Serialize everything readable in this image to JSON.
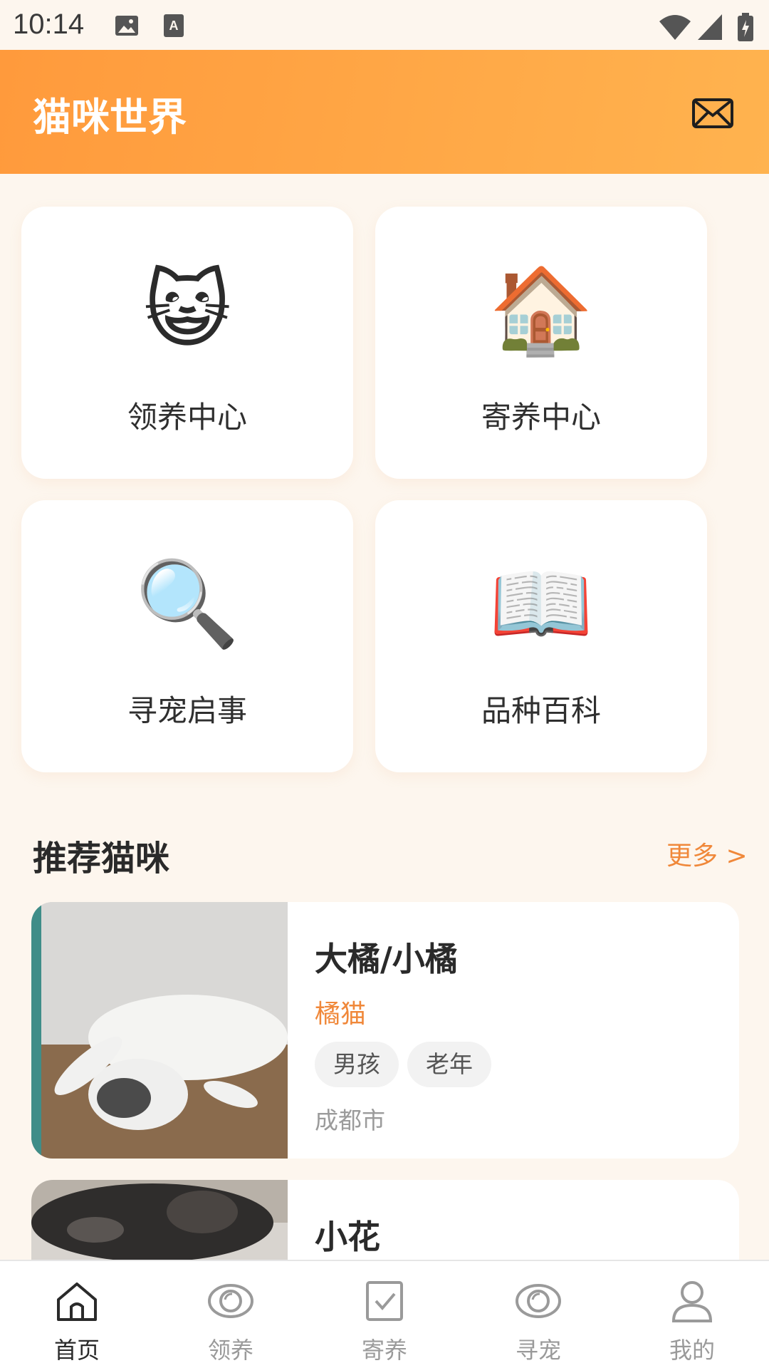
{
  "status_bar": {
    "time": "10:14"
  },
  "app_bar": {
    "title": "猫咪世界",
    "mail_icon": "mail-icon"
  },
  "quick_tiles": [
    {
      "emoji": "😺",
      "label": "领养中心"
    },
    {
      "emoji": "🏠",
      "label": "寄养中心"
    },
    {
      "emoji": "🔍",
      "label": "寻宠启事"
    },
    {
      "emoji": "📖",
      "label": "品种百科"
    }
  ],
  "recommend": {
    "title": "推荐猫咪",
    "more": "更多 >",
    "cats": [
      {
        "name": "大橘/小橘",
        "breed": "橘猫",
        "tags": [
          "男孩",
          "老年"
        ],
        "city": "成都市"
      },
      {
        "name": "小花"
      }
    ]
  },
  "bottom_nav": [
    {
      "label": "首页",
      "icon": "home-icon"
    },
    {
      "label": "领养",
      "icon": "eye-icon"
    },
    {
      "label": "寄养",
      "icon": "checkbox-icon"
    },
    {
      "label": "寻宠",
      "icon": "eye-icon"
    },
    {
      "label": "我的",
      "icon": "person-icon"
    }
  ],
  "colors": {
    "accent": "#f0883a",
    "appbar_start": "#ff9a3c",
    "appbar_end": "#ffb34f",
    "background": "#fdf6ee"
  }
}
